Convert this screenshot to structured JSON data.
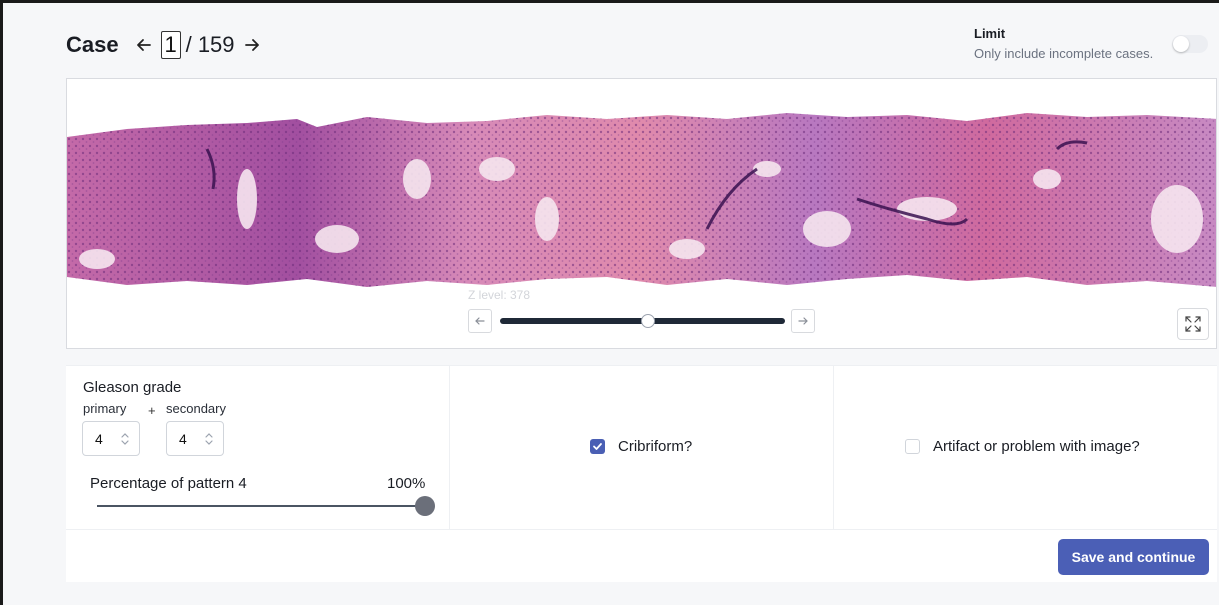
{
  "header": {
    "case_label": "Case",
    "prev_icon": "arrow-left-icon",
    "current_case": "1",
    "total_label": "/ 159",
    "next_icon": "arrow-right-icon"
  },
  "limit": {
    "title": "Limit",
    "subtitle": "Only include incomplete cases.",
    "toggle_on": false
  },
  "viewer": {
    "z_level_label": "Z level: 378",
    "z_slider_fraction": 0.52,
    "step_prev_icon": "arrow-left-icon",
    "step_next_icon": "arrow-right-icon",
    "fullscreen_icon": "expand-icon"
  },
  "gleason": {
    "title": "Gleason grade",
    "primary_label": "primary",
    "plus": "+",
    "secondary_label": "secondary",
    "primary_value": "4",
    "secondary_value": "4",
    "pattern_label": "Percentage of pattern 4",
    "pattern_value": "100%",
    "pattern_fraction": 1.0
  },
  "options": {
    "cribriform_label": "Cribriform?",
    "cribriform_checked": true,
    "artifact_label": "Artifact or problem with image?",
    "artifact_checked": false
  },
  "actions": {
    "save_label": "Save and continue"
  },
  "colors": {
    "accent": "#4b5fb6",
    "checkbox": "#4a5fb4",
    "slider_track": "#1f2937"
  }
}
